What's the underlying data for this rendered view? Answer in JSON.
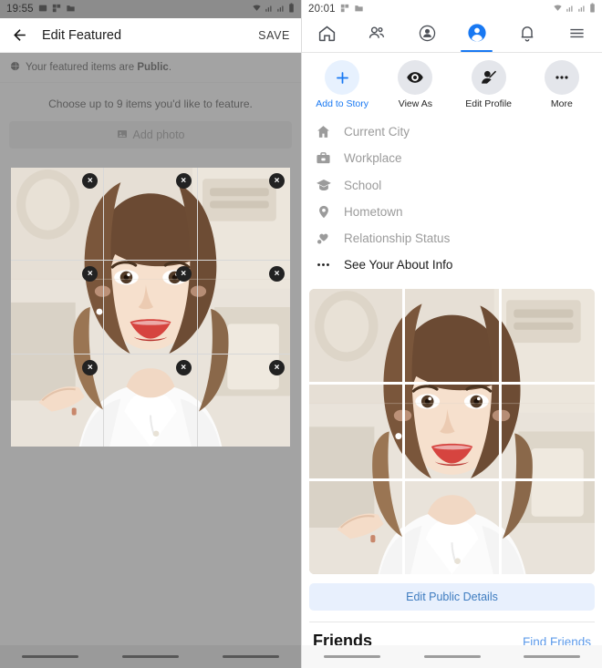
{
  "left": {
    "status": {
      "time": "19:55",
      "icons": [
        "image-icon",
        "qr-icon",
        "folder-icon"
      ],
      "right_icons": [
        "wifi-icon",
        "signal-icon",
        "signal-icon",
        "battery-icon"
      ]
    },
    "appbar": {
      "back": "back-arrow-icon",
      "title": "Edit Featured",
      "save_label": "SAVE"
    },
    "privacy": {
      "icon": "globe-icon",
      "text_before": "Your featured items are ",
      "value": "Public",
      "text_after": "."
    },
    "instruction": "Choose up to 9 items you'd like to feature.",
    "add_photo": {
      "icon": "photo-icon",
      "label": "Add photo"
    },
    "grid": {
      "remove_label": "×",
      "tiles": [
        "tile-1",
        "tile-2",
        "tile-3",
        "tile-4",
        "tile-5",
        "tile-6",
        "tile-7",
        "tile-8",
        "tile-9"
      ]
    }
  },
  "right": {
    "status": {
      "time": "20:01",
      "icons": [
        "qr-icon",
        "folder-icon"
      ],
      "right_icons": [
        "wifi-icon",
        "signal-icon",
        "signal-icon",
        "battery-icon"
      ]
    },
    "nav_tabs": [
      {
        "name": "home",
        "icon": "home-icon",
        "active": false
      },
      {
        "name": "friends",
        "icon": "friends-icon",
        "active": false
      },
      {
        "name": "groups",
        "icon": "groups-icon",
        "active": false
      },
      {
        "name": "profile",
        "icon": "profile-icon",
        "active": true
      },
      {
        "name": "notifications",
        "icon": "bell-icon",
        "active": false
      },
      {
        "name": "menu",
        "icon": "hamburger-menu-icon",
        "active": false
      }
    ],
    "actions": [
      {
        "label": "Add to Story",
        "icon": "plus-icon",
        "primary": true
      },
      {
        "label": "View As",
        "icon": "eye-icon",
        "primary": false
      },
      {
        "label": "Edit Profile",
        "icon": "edit-profile-icon",
        "primary": false
      },
      {
        "label": "More",
        "icon": "ellipsis-icon",
        "primary": false
      }
    ],
    "info_rows": [
      {
        "label": "Current City",
        "icon": "home-filled-icon",
        "dark": false
      },
      {
        "label": "Workplace",
        "icon": "briefcase-icon",
        "dark": false
      },
      {
        "label": "School",
        "icon": "graduation-cap-icon",
        "dark": false
      },
      {
        "label": "Hometown",
        "icon": "map-pin-icon",
        "dark": false
      },
      {
        "label": "Relationship Status",
        "icon": "hearts-icon",
        "dark": false
      },
      {
        "label": "See Your About Info",
        "icon": "ellipsis-icon",
        "dark": true
      }
    ],
    "featured_tiles": [
      "tile-1",
      "tile-2",
      "tile-3",
      "tile-4",
      "tile-5",
      "tile-6",
      "tile-7",
      "tile-8",
      "tile-9"
    ],
    "edit_public_details": "Edit Public Details",
    "friends": {
      "heading": "Friends",
      "link": "Find Friends"
    }
  },
  "colors": {
    "accent_blue": "#1878f2",
    "link_blue": "#5e9bea",
    "light_blue_bg": "#e8f0fd",
    "muted_gray": "#9b9b9b",
    "scrim": "rgba(110,110,110,0.62)"
  }
}
